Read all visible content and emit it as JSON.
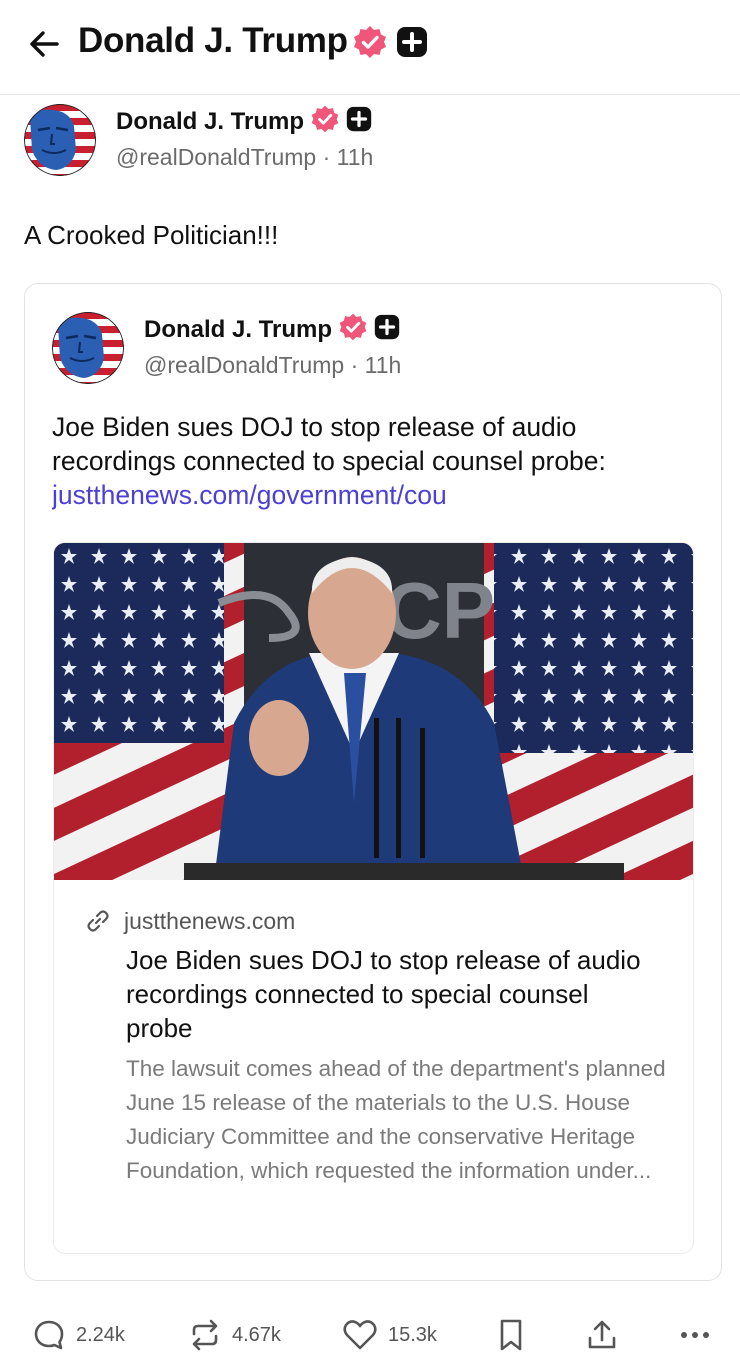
{
  "header": {
    "title": "Donald J. Trump",
    "back_icon": "arrow-left-icon"
  },
  "post": {
    "author_name": "Donald J. Trump",
    "handle": "@realDonaldTrump",
    "time": "11h",
    "meta": "@realDonaldTrump · 11h",
    "text": "A Crooked Politician!!!"
  },
  "quoted_post": {
    "author_name": "Donald J. Trump",
    "meta": "@realDonaldTrump · 11h",
    "text": "Joe Biden sues DOJ to stop release of audio recordings connected to special counsel probe:",
    "link_text": "justthenews.com/government/cou",
    "link_card": {
      "domain": "justthenews.com",
      "title": "Joe Biden sues DOJ to stop release of audio recordings connected to special counsel probe",
      "description": "The lawsuit comes ahead of the department's planned June 15 release of the materials to the U.S. House Judiciary Committee and the conservative Heritage Foundation, which requested the information under..."
    }
  },
  "actions": {
    "replies": "2.24k",
    "reposts": "4.67k",
    "likes": "15.3k"
  },
  "colors": {
    "verified_badge": "#f0557a",
    "link": "#4a3fd6",
    "muted_text": "#6b6b6b"
  }
}
